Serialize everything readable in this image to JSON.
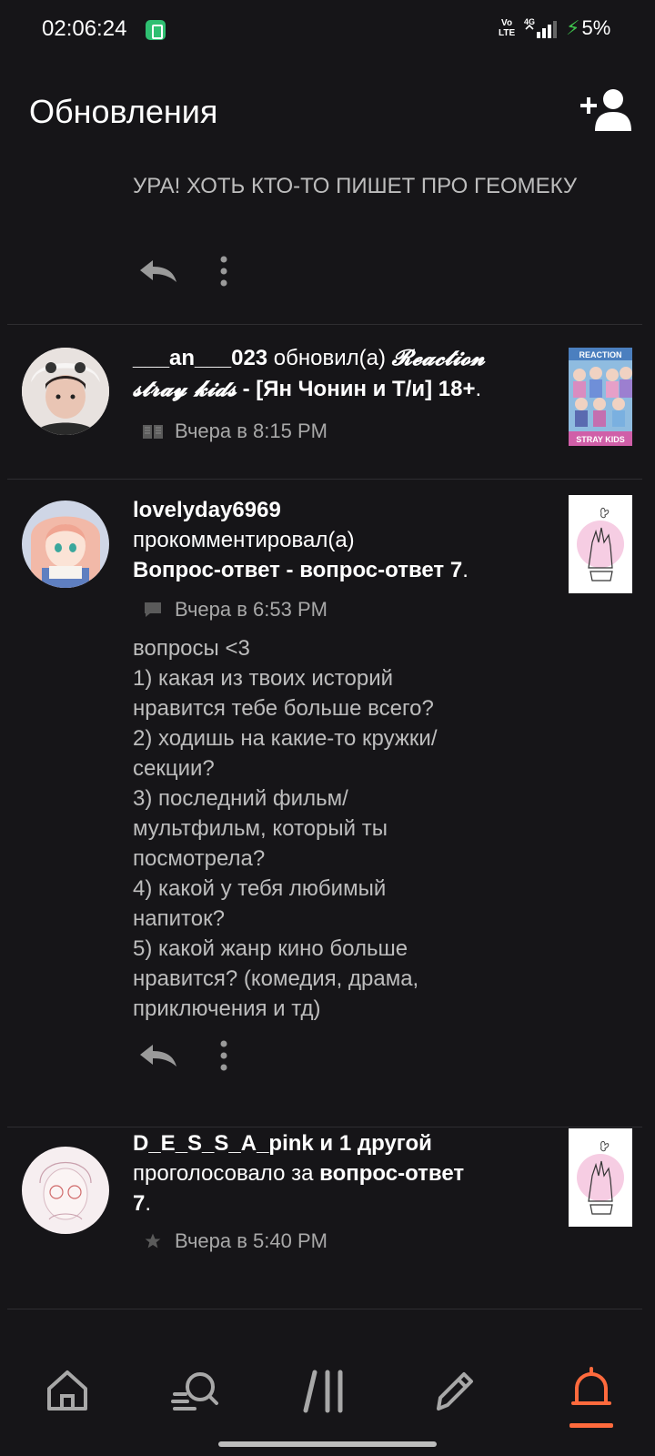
{
  "status_bar": {
    "time": "02:06:24",
    "volte_top": "Vo",
    "volte_bottom": "LTE",
    "network": "4G",
    "battery": "5%",
    "colors": {
      "app_icon": "#2fbf71",
      "charging": "#3ec04c"
    }
  },
  "header": {
    "title": "Обновления",
    "add_friend_icon": "add-person-icon"
  },
  "feed": {
    "top_comment": {
      "text": "УРА! ХОТЬ КТО-ТО ПИШЕТ ПРО ГЕОМЕКУ",
      "reply_icon": "reply-icon",
      "more_icon": "more-vertical-icon"
    },
    "items": [
      {
        "user": "___an___023",
        "action": " обновил(а) ",
        "story_fancy": "𝓡𝓮𝓪𝓬𝓽𝓲𝓸𝓷 𝓼𝓽𝓻𝓪𝔂 𝓴𝓲𝓭𝓼",
        "story_rest": " - [Ян Чонин и Т/и] 18+",
        "end": ".",
        "meta_icon": "book-icon",
        "time": "Вчера в 8:15 PM",
        "thumb_label_top": "REACTION",
        "thumb_label_bottom": "STRAY KIDS"
      },
      {
        "user": "lovelyday6969",
        "action": "прокомментировал(а)",
        "target": "Вопрос-ответ - вопрос-ответ 7",
        "end": ".",
        "meta_icon": "comment-icon",
        "time": "Вчера в 6:53 PM",
        "comment_lines": [
          "вопросы <3",
          "1) какая из твоих историй",
          "нравится тебе больше всего?",
          "2) ходишь на какие-то кружки/",
          "секции?",
          "3) последний фильм/",
          "мультфильм, который ты",
          "посмотрела?",
          "4) какой у тебя любимый",
          "напиток?",
          "5) какой жанр кино больше",
          "нравится? (комедия, драма,",
          "приключения и тд)"
        ]
      },
      {
        "user": "D_E_S_S_A_pink",
        "others": " и 1 другой",
        "action": "проголосовало за ",
        "target": "вопрос-ответ",
        "target2": "7",
        "end": ".",
        "meta_icon": "star-icon",
        "time": "Вчера в 5:40 PM"
      }
    ]
  },
  "bottom_nav": {
    "items": [
      "home-icon",
      "search-icon",
      "library-icon",
      "write-icon",
      "notifications-icon"
    ],
    "active_color": "#ff6a3d"
  }
}
